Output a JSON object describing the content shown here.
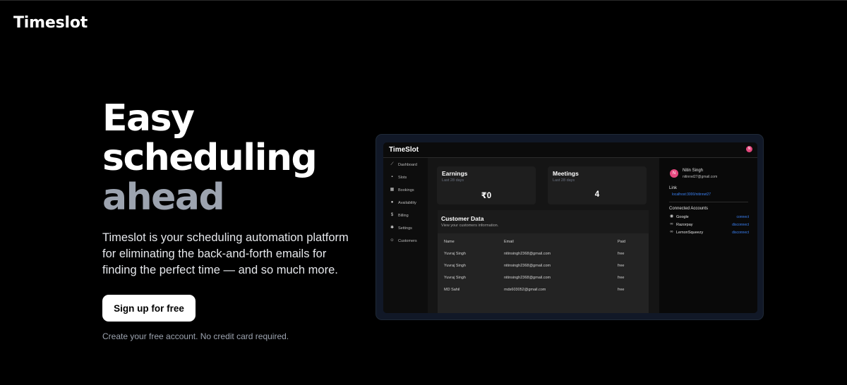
{
  "header": {
    "brand": "Timeslot"
  },
  "hero": {
    "title_line1": "Easy",
    "title_line2": "scheduling",
    "title_line3": "ahead",
    "description": "Timeslot is your scheduling automation platform for eliminating the back-and-forth emails for finding the perfect time — and so much more.",
    "cta_label": "Sign up for free",
    "note": "Create your free account. No credit card required."
  },
  "preview": {
    "logo": "TimeSlot",
    "avatar_initial": "N",
    "sidebar": [
      {
        "icon": "chart-line-icon",
        "glyph": "⟋",
        "label": "Dashboard"
      },
      {
        "icon": "slots-icon",
        "glyph": "▪",
        "label": "Slots"
      },
      {
        "icon": "calendar-icon",
        "glyph": "▦",
        "label": "Bookings"
      },
      {
        "icon": "clock-icon",
        "glyph": "●",
        "label": "Availability"
      },
      {
        "icon": "dollar-icon",
        "glyph": "$",
        "label": "Billing"
      },
      {
        "icon": "gear-icon",
        "glyph": "✱",
        "label": "Settings"
      },
      {
        "icon": "users-icon",
        "glyph": "☺",
        "label": "Customers"
      }
    ],
    "cards": [
      {
        "title": "Earnings",
        "subtitle": "Last 28 days",
        "value": "₹0"
      },
      {
        "title": "Meetings",
        "subtitle": "Last 28 days",
        "value": "4"
      }
    ],
    "customers": {
      "title": "Customer Data",
      "subtitle": "View your customers information.",
      "columns": [
        "Name",
        "Email",
        "Paid"
      ],
      "rows": [
        [
          "Yuvraj Singh",
          "nitinsingh2368@gmail.com",
          "free"
        ],
        [
          "Yuvraj Singh",
          "nitinsingh2368@gmail.com",
          "free"
        ],
        [
          "Yuvraj Singh",
          "nitinsingh2368@gmail.com",
          "free"
        ],
        [
          "MD Sahil",
          "mds603052@gmail.com",
          "free"
        ]
      ]
    },
    "profile": {
      "initial": "N",
      "name": "Nitin Singh",
      "email": "nitinrwt27@gmail.com",
      "link_label": "Link",
      "link": "localhost:3000/nitinrwt27",
      "accounts_label": "Connected Accounts",
      "accounts": [
        {
          "icon": "google-icon",
          "glyph": "◉",
          "name": "Google",
          "action": "connect"
        },
        {
          "icon": "link-icon",
          "glyph": "∞",
          "name": "Razorpay",
          "action": "disconnect"
        },
        {
          "icon": "link-icon",
          "glyph": "∞",
          "name": "LemonSqueezy",
          "action": "disconnect"
        }
      ]
    }
  }
}
